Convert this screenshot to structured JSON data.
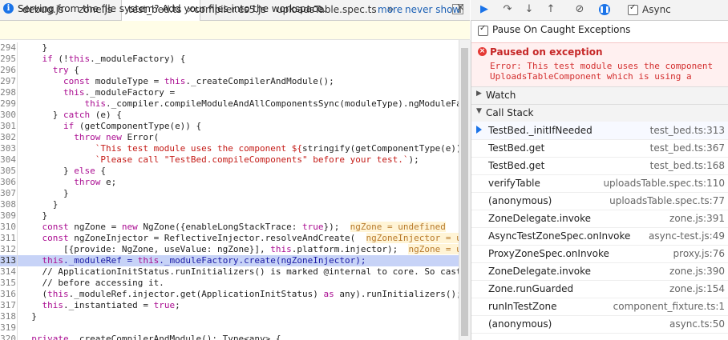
{
  "tabs": [
    {
      "label": "debug.js",
      "active": false
    },
    {
      "label": "zone.js",
      "active": false
    },
    {
      "label": "test_bed.ts",
      "active": true
    },
    {
      "label": "compiler.es5.js",
      "active": false
    },
    {
      "label": "uploadsTable.spec.ts",
      "active": false
    }
  ],
  "tab_close_glyph": "×",
  "tab_overflow_glyph": "»",
  "infobar": {
    "message": "Serving from the file system? Add your files into the workspace.",
    "more": "more",
    "never_show": "never show",
    "close": "×"
  },
  "code_lines": [
    {
      "n": "294",
      "html": "    }"
    },
    {
      "n": "295",
      "html": "    <span class=\"kw\">if</span> (!<span class=\"kw\">this</span>._moduleFactory) {"
    },
    {
      "n": "296",
      "html": "      <span class=\"kw\">try</span> {"
    },
    {
      "n": "297",
      "html": "        <span class=\"kw\">const</span> moduleType = <span class=\"kw\">this</span>._createCompilerAndModule();"
    },
    {
      "n": "298",
      "html": "        <span class=\"kw\">this</span>._moduleFactory ="
    },
    {
      "n": "299",
      "html": "            <span class=\"kw\">this</span>._compiler.compileModuleAndAllComponentsSync(moduleType).ngModuleFa"
    },
    {
      "n": "300",
      "html": "      } <span class=\"kw\">catch</span> (e) {"
    },
    {
      "n": "301",
      "html": "        <span class=\"kw\">if</span> (getComponentType(e)) {"
    },
    {
      "n": "302",
      "html": "          <span class=\"kw\">throw new</span> Error("
    },
    {
      "n": "303",
      "html": "              <span class=\"str\">`This test module uses the component ${</span>stringify(getComponentType(e))}"
    },
    {
      "n": "304",
      "html": "              <span class=\"str\">`Please call \"TestBed.compileComponents\" before your test.`</span>);"
    },
    {
      "n": "305",
      "html": "        } <span class=\"kw\">else</span> {"
    },
    {
      "n": "306",
      "html": "          <span class=\"kw\">throw</span> e;"
    },
    {
      "n": "307",
      "html": "        }"
    },
    {
      "n": "308",
      "html": "      }"
    },
    {
      "n": "309",
      "html": "    }"
    },
    {
      "n": "310",
      "html": "    <span class=\"kw\">const</span> ngZone = <span class=\"kw\">new</span> NgZone({enableLongStackTrace: <span class=\"kw\">true</span>});  <span class=\"inl\">ngZone = undefined</span>"
    },
    {
      "n": "311",
      "html": "    <span class=\"kw\">const</span> ngZoneInjector = ReflectiveInjector.resolveAndCreate(  <span class=\"inl\">ngZoneInjector = u</span>"
    },
    {
      "n": "312",
      "html": "        [{provide: NgZone, useValue: ngZone}], <span class=\"kw\">this</span>.platform.injector);  <span class=\"inl\">ngZone = u</span>"
    },
    {
      "n": "313",
      "html": "    <span class=\"kw\">this</span>._moduleRef = <span class=\"kw\">this</span>._moduleFactory.create(ngZoneInjector);",
      "highlight": true
    },
    {
      "n": "314",
      "html": "    // ApplicationInitStatus.runInitializers() is marked @internal to core. So cast"
    },
    {
      "n": "315",
      "html": "    // before accessing it."
    },
    {
      "n": "316",
      "html": "    (<span class=\"kw\">this</span>._moduleRef.injector.get(ApplicationInitStatus) <span class=\"kw\">as</span> any).runInitializers();"
    },
    {
      "n": "317",
      "html": "    <span class=\"kw\">this</span>._instantiated = <span class=\"kw\">true</span>;"
    },
    {
      "n": "318",
      "html": "  }"
    },
    {
      "n": "319",
      "html": ""
    },
    {
      "n": "320",
      "html": "  <span class=\"kw\">private</span> _createCompilerAndModule(): Type&lt;any&gt; {"
    }
  ],
  "toolbar": {
    "async_label": "Async",
    "async_checked": true
  },
  "pause_on_caught": {
    "label": "Pause On Caught Exceptions",
    "checked": true
  },
  "exception": {
    "title": "Paused on exception",
    "message": "Error: This test module uses the component\nUploadsTableComponent which is using a"
  },
  "watch": {
    "title": "Watch"
  },
  "call_stack": {
    "title": "Call Stack",
    "frames": [
      {
        "name": "TestBed._initIfNeeded",
        "loc": "test_bed.ts:313",
        "current": true
      },
      {
        "name": "TestBed.get",
        "loc": "test_bed.ts:367"
      },
      {
        "name": "TestBed.get",
        "loc": "test_bed.ts:168"
      },
      {
        "name": "verifyTable",
        "loc": "uploadsTable.spec.ts:110"
      },
      {
        "name": "(anonymous)",
        "loc": "uploadsTable.spec.ts:77"
      },
      {
        "name": "ZoneDelegate.invoke",
        "loc": "zone.js:391"
      },
      {
        "name": "AsyncTestZoneSpec.onInvoke",
        "loc": "async-test.js:49"
      },
      {
        "name": "ProxyZoneSpec.onInvoke",
        "loc": "proxy.js:76"
      },
      {
        "name": "ZoneDelegate.invoke",
        "loc": "zone.js:390"
      },
      {
        "name": "Zone.runGuarded",
        "loc": "zone.js:154"
      },
      {
        "name": "runInTestZone",
        "loc": "component_fixture.ts:1"
      },
      {
        "name": "(anonymous)",
        "loc": "async.ts:50"
      }
    ]
  }
}
